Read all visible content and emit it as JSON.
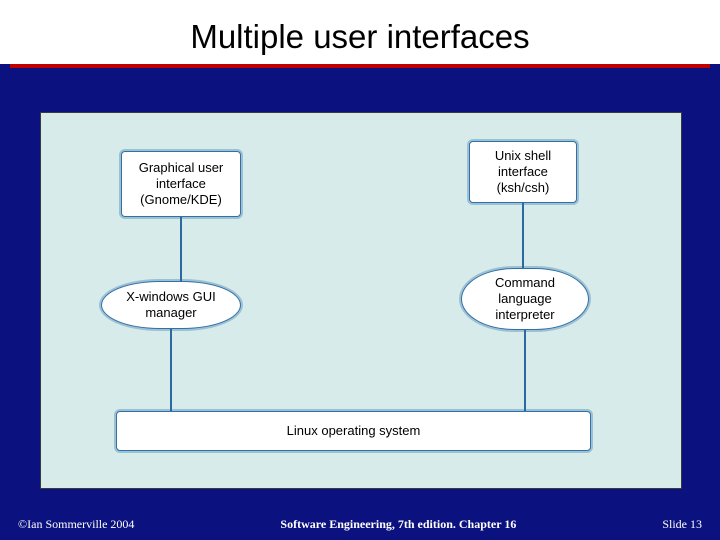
{
  "title": "Multiple user interfaces",
  "diagram": {
    "gui_box": "Graphical user\ninterface\n(Gnome/KDE)",
    "shell_box": "Unix shell\ninterface\n(ksh/csh)",
    "xwin_box": "X-windows GUI\nmanager",
    "cli_box": "Command\nlanguage\ninterpreter",
    "os_box": "Linux operating system"
  },
  "footer": {
    "left": "©Ian Sommerville 2004",
    "middle": "Software Engineering, 7th edition. Chapter 16",
    "right": "Slide 13"
  }
}
